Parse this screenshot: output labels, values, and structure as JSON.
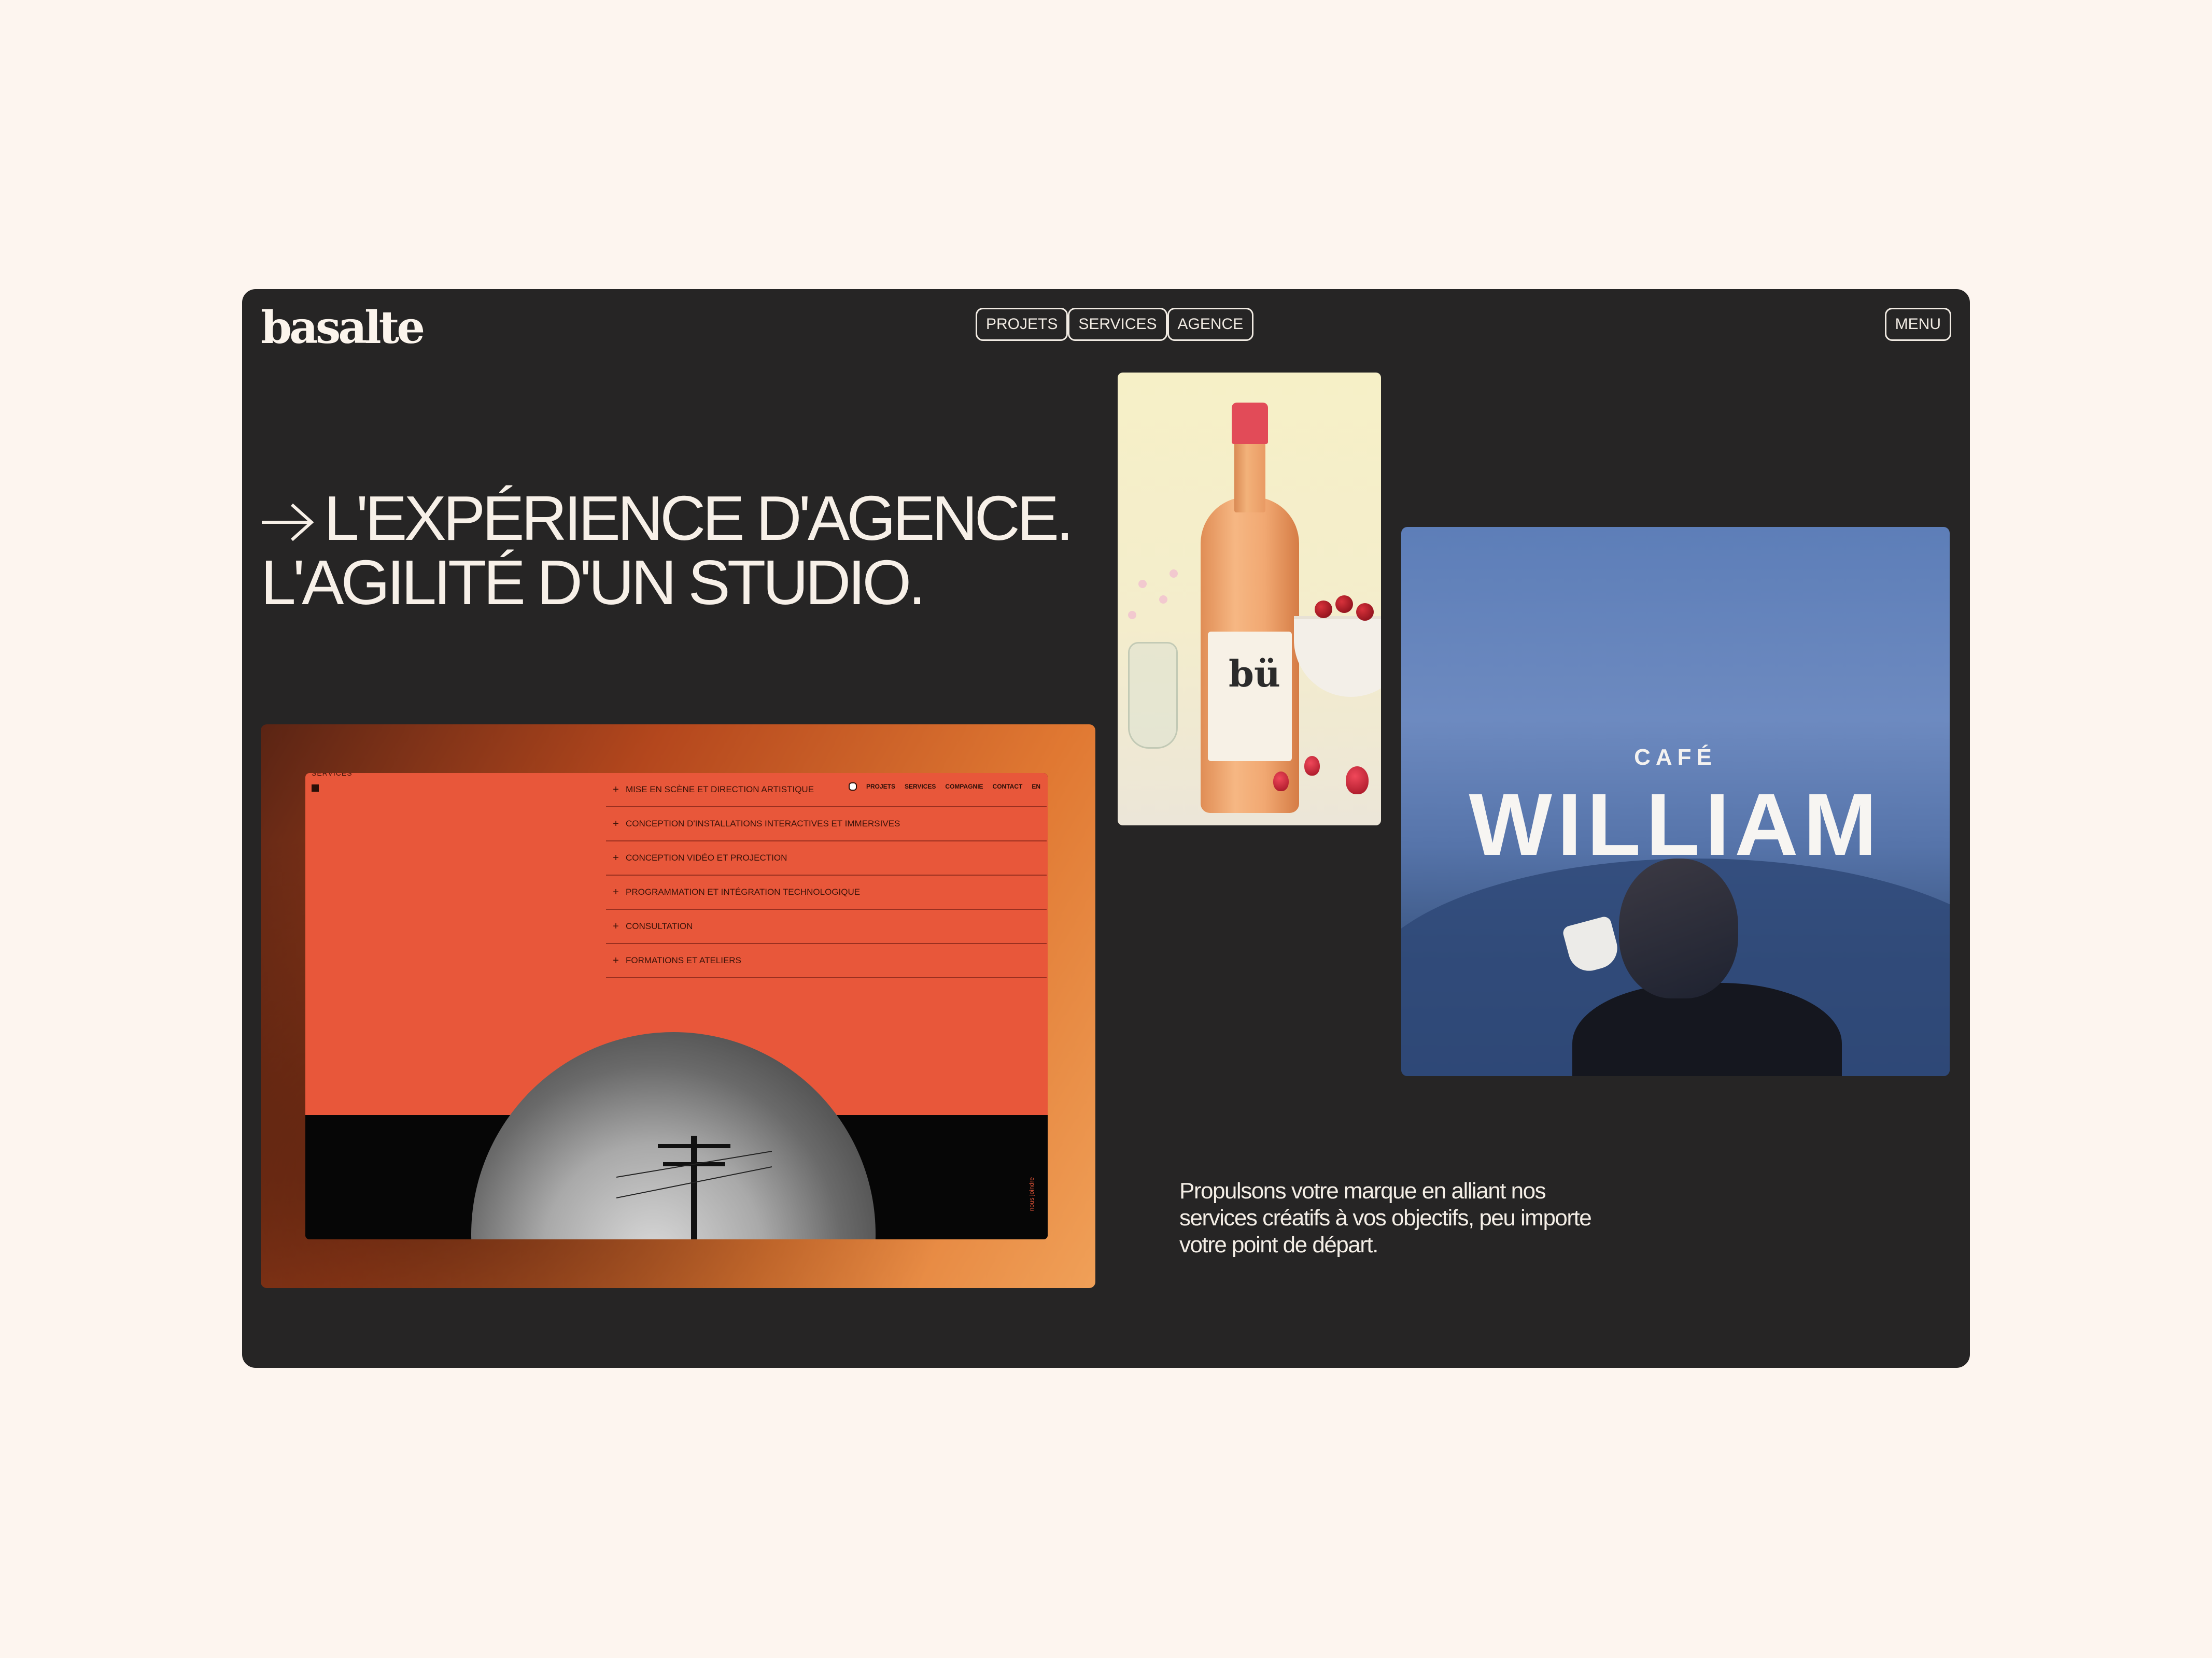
{
  "brand": {
    "logo_text": "basalte"
  },
  "nav": {
    "items": [
      "PROJETS",
      "SERVICES",
      "AGENCE"
    ],
    "menu_label": "MENU"
  },
  "hero": {
    "line1": "L'EXPÉRIENCE D'AGENCE.",
    "line2": "L'AGILITÉ D'UN STUDIO."
  },
  "services_card": {
    "section_label": "SERVICES",
    "top_nav": [
      "PROJETS",
      "SERVICES",
      "COMPAGNIE",
      "CONTACT",
      "EN"
    ],
    "items": [
      "MISE EN SCÈNE ET DIRECTION ARTISTIQUE",
      "CONCEPTION D'INSTALLATIONS INTERACTIVES ET IMMERSIVES",
      "CONCEPTION VIDÉO ET PROJECTION",
      "PROGRAMMATION ET INTÉGRATION TECHNOLOGIQUE",
      "CONSULTATION",
      "FORMATIONS ET ATELIERS"
    ],
    "credit": "nous joindre"
  },
  "wine_card": {
    "label_text": "bü"
  },
  "cafe_card": {
    "pretitle": "CAFÉ",
    "title": "WILLIAM"
  },
  "tagline": "Propulsons votre marque en alliant nos services créatifs à vos objectifs, peu importe votre point de départ.",
  "colors": {
    "page_bg": "#fdf5ef",
    "frame_bg": "#262525",
    "text_light": "#f7f0e8",
    "accent_orange": "#e8573a",
    "cafe_blue": "#5d7eb8"
  },
  "icons": {
    "hero_arrow": "arrow-right-icon"
  }
}
